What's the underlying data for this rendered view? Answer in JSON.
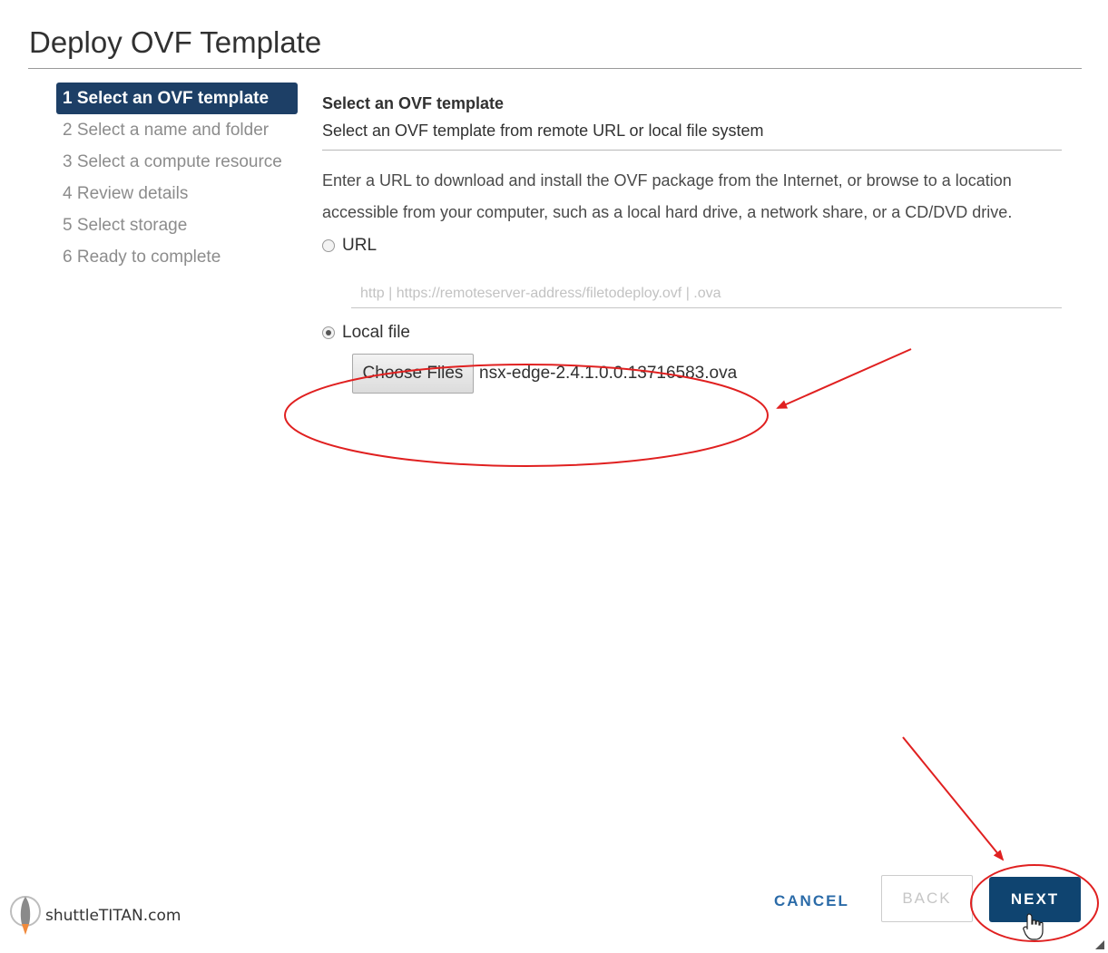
{
  "dialog": {
    "title": "Deploy OVF Template"
  },
  "steps": [
    {
      "label": "1 Select an OVF template",
      "active": true
    },
    {
      "label": "2 Select a name and folder"
    },
    {
      "label": "3 Select a compute resource"
    },
    {
      "label": "4 Review details"
    },
    {
      "label": "5 Select storage"
    },
    {
      "label": "6 Ready to complete"
    }
  ],
  "content": {
    "title": "Select an OVF template",
    "subtitle": "Select an OVF template from remote URL or local file system",
    "description": "Enter a URL to download and install the OVF package from the Internet, or browse to a location accessible from your computer, such as a local hard drive, a network share, or a CD/DVD drive.",
    "url_option_label": "URL",
    "url_placeholder": "http | https://remoteserver-address/filetodeploy.ovf | .ova",
    "local_option_label": "Local file",
    "choose_files_label": "Choose Files",
    "selected_file": "nsx-edge-2.4.1.0.0.13716583.ova"
  },
  "footer": {
    "cancel_label": "CANCEL",
    "back_label": "BACK",
    "next_label": "NEXT"
  },
  "watermark": {
    "text": "shuttleTITAN.com"
  },
  "colors": {
    "active_step_bg": "#1d3f66",
    "next_bg": "#0f4470",
    "link": "#2b6ba8",
    "annotation": "#e02020"
  },
  "icons": [
    "radio-unchecked-icon",
    "radio-checked-icon",
    "hand-cursor-icon",
    "resize-grip-icon",
    "rocket-logo-icon"
  ]
}
